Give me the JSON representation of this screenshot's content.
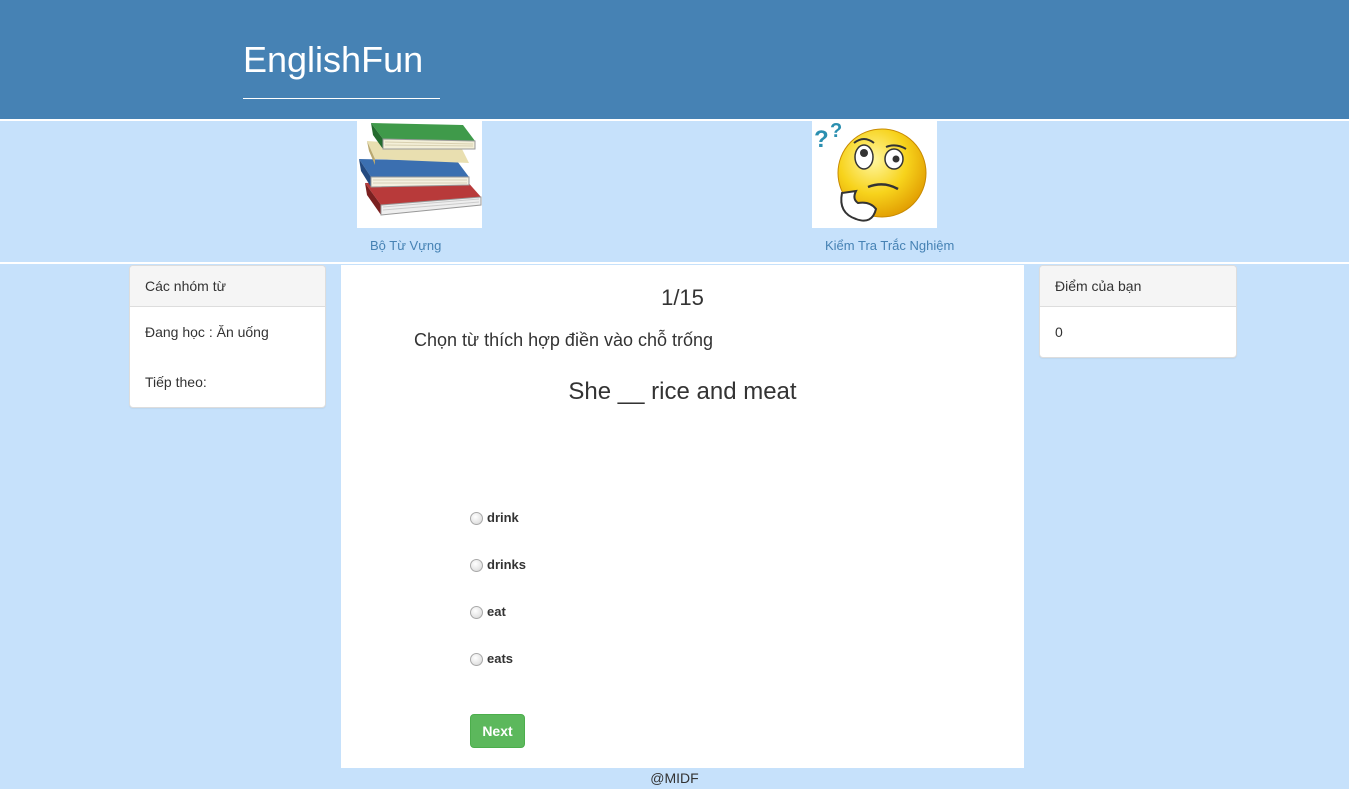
{
  "header": {
    "brand": "EnglishFun"
  },
  "nav": [
    {
      "label": "Bộ Từ Vựng",
      "icon": "books-icon"
    },
    {
      "label": "Kiểm Tra Trắc Nghiệm",
      "icon": "thinking-face-icon"
    }
  ],
  "left_panel": {
    "title": "Các nhóm từ",
    "current": "Đang học : Ăn uống",
    "next": "Tiếp theo:"
  },
  "quiz": {
    "counter": "1/15",
    "instruction": "Chọn từ thích hợp điền vào chỗ trống",
    "question": "She __ rice and meat",
    "options": [
      "drink",
      "drinks",
      "eat",
      "eats"
    ],
    "next_label": "Next"
  },
  "right_panel": {
    "title": "Điểm của bạn",
    "score": "0"
  },
  "footer": {
    "text": "@MIDF"
  },
  "colors": {
    "header_bg": "#4682b4",
    "page_bg": "#c6e1fb",
    "button_bg": "#5cb85c",
    "link": "#4682b4"
  }
}
